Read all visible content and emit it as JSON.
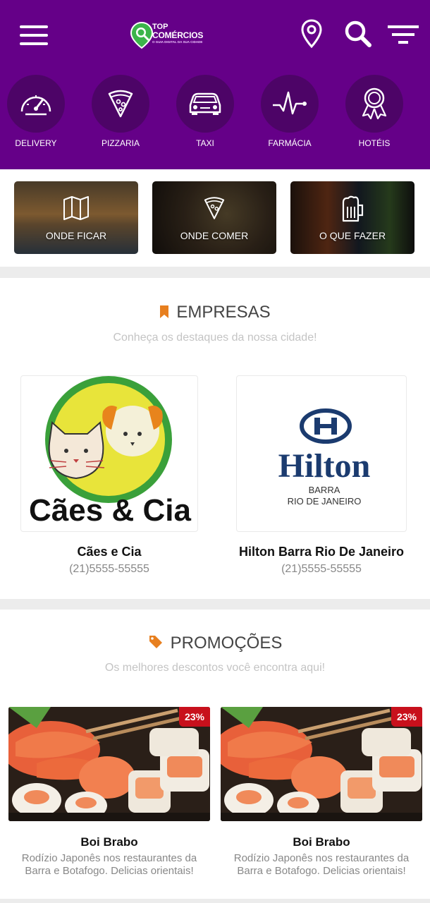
{
  "app": {
    "logo_top": "TOP",
    "logo_name": "COMÉRCIOS",
    "logo_tagline": "O GUIA DIGITAL DA SUA CIDADE"
  },
  "header_icons": [
    "menu-icon",
    "location-pin-icon",
    "search-icon",
    "filter-icon"
  ],
  "categories": [
    {
      "label": "DELIVERY",
      "icon": "speedometer-icon"
    },
    {
      "label": "PIZZARIA",
      "icon": "pizza-slice-icon"
    },
    {
      "label": "TAXI",
      "icon": "car-icon"
    },
    {
      "label": "FARMÁCIA",
      "icon": "heartbeat-icon"
    },
    {
      "label": "HOTÉIS",
      "icon": "award-ribbon-icon"
    }
  ],
  "tiles": [
    {
      "label": "ONDE FICAR",
      "icon": "map-icon"
    },
    {
      "label": "ONDE COMER",
      "icon": "pizza-slice-icon"
    },
    {
      "label": "O QUE FAZER",
      "icon": "beer-mug-icon"
    }
  ],
  "companies": {
    "title": "EMPRESAS",
    "subtitle": "Conheça os destaques da nossa cidade!",
    "items": [
      {
        "name": "Cães e Cia",
        "phone": "(21)5555-55555",
        "logo_text": "Cães & Cia"
      },
      {
        "name": "Hilton Barra Rio De Janeiro",
        "phone": "(21)5555-55555",
        "logo_text": "Hilton",
        "logo_sub1": "BARRA",
        "logo_sub2": "RIO DE JANEIRO"
      }
    ]
  },
  "promotions": {
    "title": "PROMOÇÕES",
    "subtitle": "Os melhores descontos você encontra aqui!",
    "items": [
      {
        "name": "Boi Brabo",
        "discount": "23%",
        "desc_line1": "Rodízio Japonês nos restaurantes da",
        "desc_line2": "Barra e Botafogo. Delicias orientais!"
      },
      {
        "name": "Boi Brabo",
        "discount": "23%",
        "desc_line1": "Rodízio Japonês nos restaurantes da",
        "desc_line2": "Barra e Botafogo. Delicias orientais!"
      }
    ]
  },
  "colors": {
    "header_bg": "#650088",
    "category_circle": "#4d0467",
    "accent_orange": "#e77f1f",
    "badge_red": "#c8101c",
    "hilton_blue": "#1b3b6f"
  }
}
